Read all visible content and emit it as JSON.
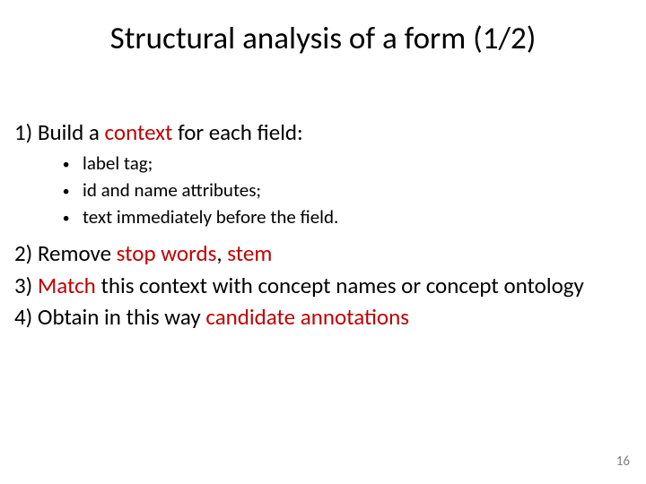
{
  "title": "Structural analysis of a form (1/2)",
  "item1": {
    "lead": "1) ",
    "a": "Build a ",
    "b": "context",
    "c": " for each field:"
  },
  "sub": {
    "a": {
      "pre": "label",
      "post": " tag;"
    },
    "b": {
      "pre": "id",
      "mid": " and ",
      "mid2": "name",
      "post": " attributes;"
    },
    "c": "text immediately before the field."
  },
  "item2": {
    "lead": "2) ",
    "a": "Remove ",
    "b": "stop words",
    "c": ", ",
    "d": "stem"
  },
  "item3": {
    "lead": "3) ",
    "a": "Match",
    "b": " this context with concept names or concept ontology"
  },
  "item4": {
    "lead": "4) ",
    "a": "Obtain in this way ",
    "b": "candidate annotations"
  },
  "page_number": "16"
}
